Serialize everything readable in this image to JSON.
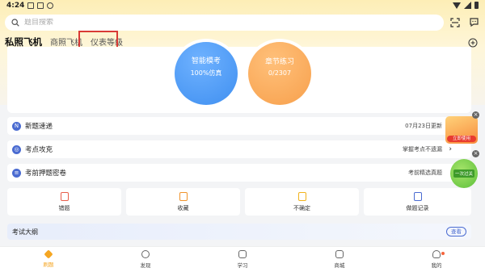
{
  "status_bar": {
    "time": "4:24"
  },
  "search": {
    "placeholder": "题目搜索"
  },
  "tabs": [
    {
      "label": "私照飞机",
      "active": true
    },
    {
      "label": "商照飞机",
      "active": false
    },
    {
      "label": "仪表等级",
      "active": false
    }
  ],
  "practice": {
    "mock": {
      "title": "智能模考",
      "sub": "100%仿真"
    },
    "chapter": {
      "title": "章节练习",
      "sub": "0/2307"
    }
  },
  "list": [
    {
      "icon": "new-icon",
      "label": "新题速递",
      "right": "07月23日更新"
    },
    {
      "icon": "target-icon",
      "label": "考点攻克",
      "right": "掌握考点不遗漏"
    },
    {
      "icon": "paper-icon",
      "label": "考前押题密卷",
      "right": "考前精选真题"
    }
  ],
  "quick": [
    {
      "icon": "wrong-icon",
      "label": "错题"
    },
    {
      "icon": "favorite-icon",
      "label": "收藏"
    },
    {
      "icon": "unsure-icon",
      "label": "不确定"
    },
    {
      "icon": "record-icon",
      "label": "做题记录"
    }
  ],
  "outline": {
    "label": "考试大纲",
    "button": "查看"
  },
  "promo": {
    "top": {
      "text": "立即使用"
    },
    "bottom": {
      "text": "一次过关"
    }
  },
  "nav": [
    {
      "icon": "home-icon",
      "label": "刷题",
      "active": true
    },
    {
      "icon": "compass-icon",
      "label": "发现",
      "active": false
    },
    {
      "icon": "study-icon",
      "label": "学习",
      "active": false
    },
    {
      "icon": "shop-icon",
      "label": "商城",
      "active": false
    },
    {
      "icon": "user-icon",
      "label": "我的",
      "active": false,
      "badge": true
    }
  ],
  "colors": {
    "accent": "#f5a623",
    "mock": "#3f8ff0",
    "chapter": "#f7a04c",
    "annotation": "#d93a35"
  }
}
